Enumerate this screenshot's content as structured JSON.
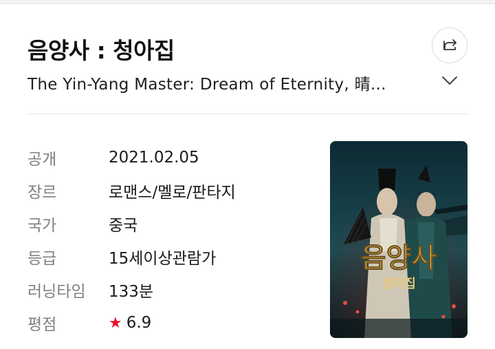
{
  "movie": {
    "title": "음양사 : 청아집",
    "subtitle": "The Yin-Yang Master: Dream of Eternity, 晴...",
    "share_icon": "share-icon",
    "expand_icon": "chevron-down-icon"
  },
  "details": [
    {
      "label": "공개",
      "value": "2021.02.05"
    },
    {
      "label": "장르",
      "value": "로맨스/멜로/판타지"
    },
    {
      "label": "국가",
      "value": "중국"
    },
    {
      "label": "등급",
      "value": "15세이상관람가"
    },
    {
      "label": "러닝타임",
      "value": "133분"
    },
    {
      "label": "평점",
      "value": "6.9",
      "icon": "star-icon"
    }
  ],
  "poster": {
    "title_big": "음양사",
    "title_small": "청아집"
  },
  "colors": {
    "accent_star": "#e8102f",
    "label": "#808080",
    "poster_gold": "#d9b55a"
  }
}
